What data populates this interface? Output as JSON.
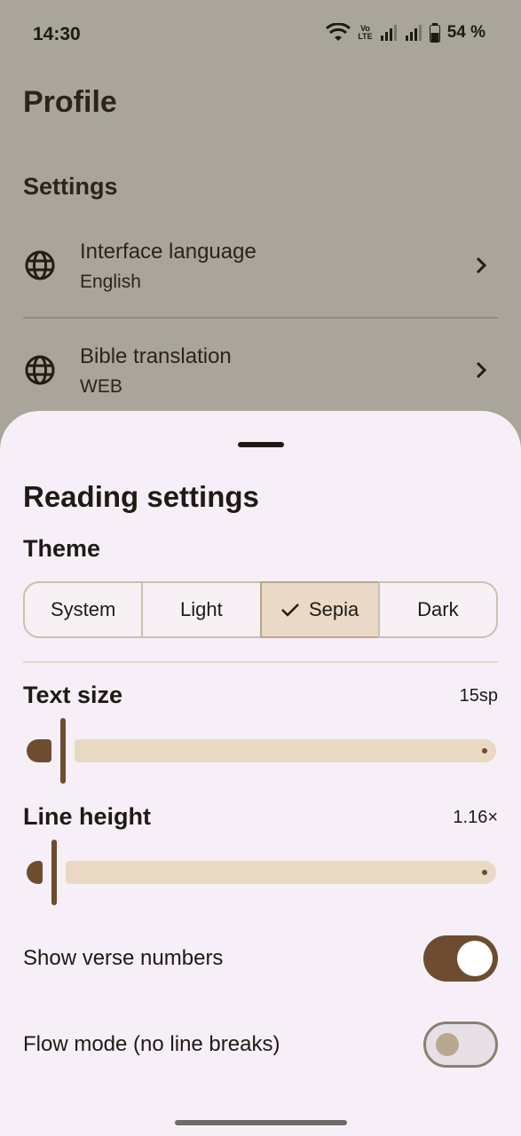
{
  "status_bar": {
    "time": "14:30",
    "battery": "54 %",
    "icons": [
      "wifi-icon",
      "volte-icon",
      "signal-icon",
      "signal-icon",
      "battery-icon"
    ],
    "volte_text_top": "Vo",
    "volte_text_bottom": "LTE"
  },
  "background_page": {
    "title": "Profile",
    "section_title": "Settings",
    "rows": [
      {
        "title": "Interface language",
        "subtitle": "English",
        "icon": "globe-icon"
      },
      {
        "title": "Bible translation",
        "subtitle": "WEB",
        "icon": "globe-icon"
      }
    ]
  },
  "sheet": {
    "title": "Reading settings",
    "theme": {
      "label": "Theme",
      "options": [
        "System",
        "Light",
        "Sepia",
        "Dark"
      ],
      "selected": "Sepia"
    },
    "text_size": {
      "label": "Text size",
      "value": "15sp",
      "level": 0.0
    },
    "line_height": {
      "label": "Line height",
      "value": "1.16×",
      "level": 0.0
    },
    "show_verse_numbers": {
      "label": "Show verse numbers",
      "on": true
    },
    "flow_mode": {
      "label": "Flow mode (no line breaks)",
      "on": false
    }
  },
  "colors": {
    "accent": "#6d4c2f",
    "track": "#e9d8c2",
    "sheet_background": "#f6eff7",
    "scrim_background": "#a9a59b"
  }
}
